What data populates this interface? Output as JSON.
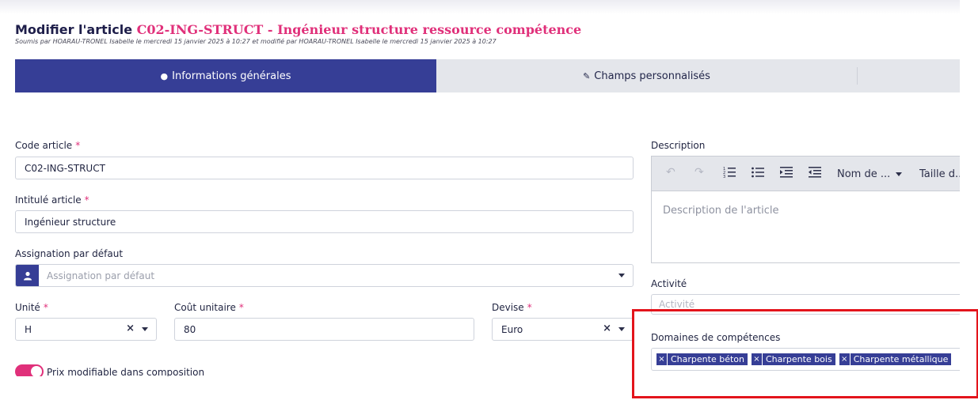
{
  "header": {
    "title_prefix": "Modifier l'article",
    "title_code": "C02-ING-STRUCT - Ingénieur structure ressource compétence",
    "subtitle": "Soumis par HOARAU-TRONEL Isabelle le mercredi 15 janvier 2025 à 10:27 et modifié par HOARAU-TRONEL Isabelle le mercredi 15 janvier 2025 à 10:27"
  },
  "tabs": [
    {
      "label": "Informations générales",
      "icon": "info-circle-icon",
      "icon_glyph": "●"
    },
    {
      "label": "Champs personnalisés",
      "icon": "user-edit-icon",
      "icon_glyph": "✎"
    }
  ],
  "form": {
    "code": {
      "label": "Code article",
      "required": "*",
      "value": "C02-ING-STRUCT"
    },
    "intitule": {
      "label": "Intitulé article",
      "required": "*",
      "value": "Ingénieur structure"
    },
    "assignation": {
      "label": "Assignation par défaut",
      "placeholder": "Assignation par défaut"
    },
    "unite": {
      "label": "Unité",
      "required": "*",
      "value": "H"
    },
    "cout": {
      "label": "Coût unitaire",
      "required": "*",
      "value": "80"
    },
    "devise": {
      "label": "Devise",
      "required": "*",
      "value": "Euro"
    },
    "prix_modifiable": {
      "label": "Prix modifiable dans composition",
      "checked": true
    }
  },
  "description": {
    "label": "Description",
    "placeholder": "Description de l'article",
    "toolbar": {
      "font_name": "Nom de ...",
      "font_size": "Taille d..."
    }
  },
  "activite": {
    "label": "Activité",
    "placeholder": "Activité"
  },
  "domaines": {
    "label": "Domaines de compétences",
    "tags": [
      "Charpente béton",
      "Charpente bois",
      "Charpente métallique"
    ]
  },
  "colors": {
    "primary": "#363e96",
    "accent": "#e0307a",
    "highlight": "#e3141b"
  }
}
